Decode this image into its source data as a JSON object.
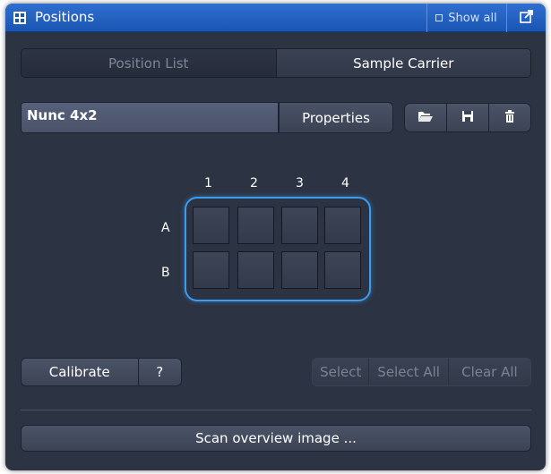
{
  "window": {
    "title": "Positions",
    "show_all_label": "Show all",
    "app_icon": "positions-panel-icon",
    "detach_icon": "detach-window-icon"
  },
  "tabs": [
    {
      "label": "Position List",
      "active": false
    },
    {
      "label": "Sample Carrier",
      "active": true
    }
  ],
  "carrier": {
    "name": "Nunc 4x2",
    "properties_label": "Properties",
    "icons": [
      "open-folder-icon",
      "save-icon",
      "delete-icon"
    ]
  },
  "grid": {
    "columns": [
      "1",
      "2",
      "3",
      "4"
    ],
    "rows": [
      "A",
      "B"
    ],
    "highlight_color": "#3c9cf0"
  },
  "actions": {
    "calibrate_label": "Calibrate",
    "help_label": "?",
    "select_label": "Select",
    "select_all_label": "Select All",
    "clear_all_label": "Clear All",
    "scan_label": "Scan overview image ..."
  },
  "colors": {
    "titlebar": "#1b55b3",
    "panel_bg": "#2c3342"
  }
}
